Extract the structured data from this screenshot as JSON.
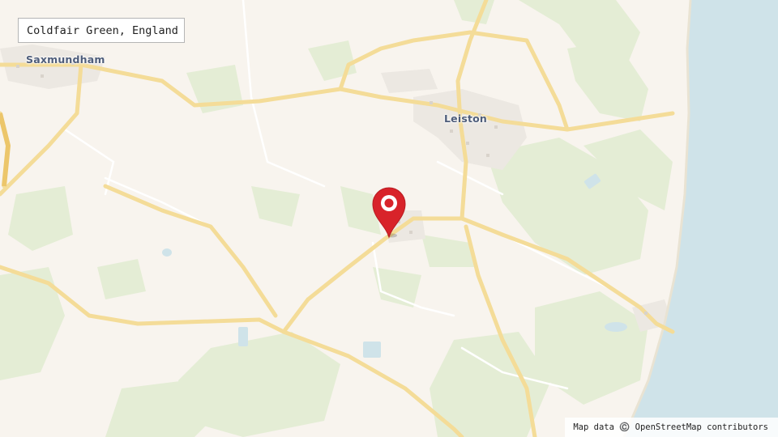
{
  "search": {
    "value": "Coldfair Green, England"
  },
  "places": [
    {
      "id": "saxmundham",
      "name": "Saxmundham"
    },
    {
      "id": "leiston",
      "name": "Leiston"
    }
  ],
  "marker": {
    "icon": "map-pin-icon",
    "color": "#d8232a"
  },
  "attribution": "Map data ©️ OpenStreetMap contributors",
  "colors": {
    "land": "#f8f4ee",
    "green": "#e2ecd2",
    "water": "#cfe3e9",
    "road": "#f7e4a8",
    "town": "#eeeae4"
  }
}
